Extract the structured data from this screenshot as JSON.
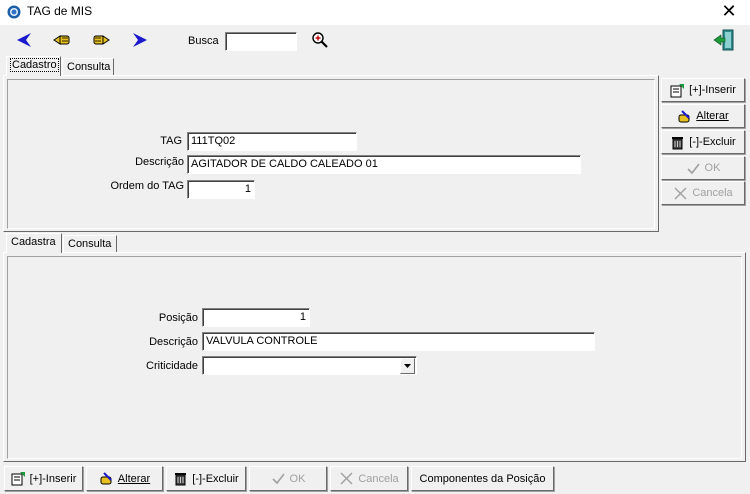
{
  "window": {
    "title": "TAG de MIS",
    "close_glyph": "✕"
  },
  "toolbar": {
    "buttons": [
      "first-icon",
      "previous-icon",
      "next-icon",
      "last-icon"
    ],
    "busca_label": "Busca",
    "busca_value": "",
    "search_icon": "magnifier-icon",
    "exit_icon": "exit-door-icon"
  },
  "top_tabs": [
    {
      "label": "Cadastro"
    },
    {
      "label": "Consulta"
    }
  ],
  "tag_form": {
    "tag_label": "TAG",
    "tag_value": "111TQ02",
    "descricao_label": "Descrição",
    "descricao_value": "AGITADOR DE CALDO CALEADO 01",
    "ordem_label": "Ordem do TAG",
    "ordem_value": "1"
  },
  "side_buttons": {
    "inserir": "[+]-Inserir",
    "alterar": "Alterar",
    "excluir": "[-]-Excluir",
    "ok": "OK",
    "cancela": "Cancela"
  },
  "bottom_tabs": [
    {
      "label": "Cadastra"
    },
    {
      "label": "Consulta"
    }
  ],
  "posicao_form": {
    "posicao_label": "Posição",
    "posicao_value": "1",
    "descricao_label": "Descrição",
    "descricao_value": "VALVULA CONTROLE",
    "criticidade_label": "Criticidade",
    "criticidade_value": ""
  },
  "bottom_buttons": {
    "inserir": "[+]-Inserir",
    "alterar": "Alterar",
    "excluir": "[-]-Excluir",
    "ok": "OK",
    "cancela": "Cancela",
    "componentes": "Componentes da Posição"
  },
  "colors": {
    "accent_blue": "#1a1acc",
    "hand_yellow": "#e8c020",
    "disabled_gray": "#a0a0a0"
  }
}
